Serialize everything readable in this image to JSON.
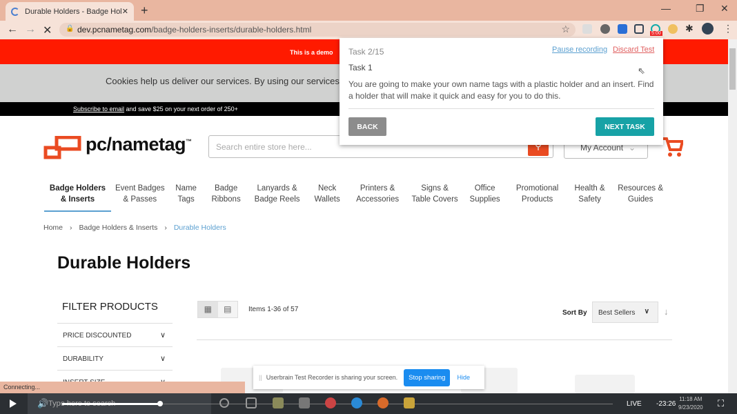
{
  "browser": {
    "tab_title": "Durable Holders - Badge Holders",
    "url_host": "dev.pcnametag.com",
    "url_path": "/badge-holders-inserts/durable-holders.html",
    "badge_timer": "5:00"
  },
  "banners": {
    "demo": "This is a demo",
    "cookie": "Cookies help us deliver our services. By using our services,",
    "subscribe_link": "Subscribe to email",
    "subscribe_rest": " and save $25 on your next order of 250+"
  },
  "header": {
    "logo": "pc/nametag",
    "logo_tm": "™",
    "search_placeholder": "Search entire store here...",
    "account": "My Account",
    "accent": "#ea4b22"
  },
  "menu": [
    {
      "l1": "Badge Holders",
      "l2": "& Inserts",
      "active": true
    },
    {
      "l1": "Event Badges",
      "l2": "& Passes"
    },
    {
      "l1": "Name",
      "l2": "Tags"
    },
    {
      "l1": "Badge",
      "l2": "Ribbons"
    },
    {
      "l1": "Lanyards &",
      "l2": "Badge Reels"
    },
    {
      "l1": "Neck",
      "l2": "Wallets"
    },
    {
      "l1": "Printers &",
      "l2": "Accessories"
    },
    {
      "l1": "Signs &",
      "l2": "Table Covers"
    },
    {
      "l1": "Office",
      "l2": "Supplies"
    },
    {
      "l1": "Promotional",
      "l2": "Products"
    },
    {
      "l1": "Health &",
      "l2": "Safety"
    },
    {
      "l1": "Resources &",
      "l2": "Guides"
    }
  ],
  "breadcrumb": [
    "Home",
    "Badge Holders & Inserts",
    "Durable Holders"
  ],
  "page_title": "Durable Holders",
  "filters": {
    "heading": "FILTER PRODUCTS",
    "items": [
      "PRICE DISCOUNTED",
      "DURABILITY",
      "INSERT SIZE"
    ]
  },
  "toolbar": {
    "items": "Items 1-36 of 57",
    "sort_label": "Sort By",
    "sort_value": "Best Sellers"
  },
  "popup": {
    "task_count": "Task 2/15",
    "pause": "Pause recording",
    "discard": "Discard Test",
    "title": "Task 1",
    "description": "You are going to make your own name tags with a plastic holder and an insert. Find a holder that will make it quick and easy for you to do this.",
    "back": "BACK",
    "next": "NEXT TASK"
  },
  "share_bar": {
    "message": "Userbrain Test Recorder is sharing your screen.",
    "stop": "Stop sharing",
    "hide": "Hide"
  },
  "status": "Connecting...",
  "player": {
    "search": "Type here to search",
    "live": "LIVE",
    "time": "-23:26",
    "clock_time": "11:18 AM",
    "clock_date": "9/23/2020",
    "progress": 0.2
  }
}
